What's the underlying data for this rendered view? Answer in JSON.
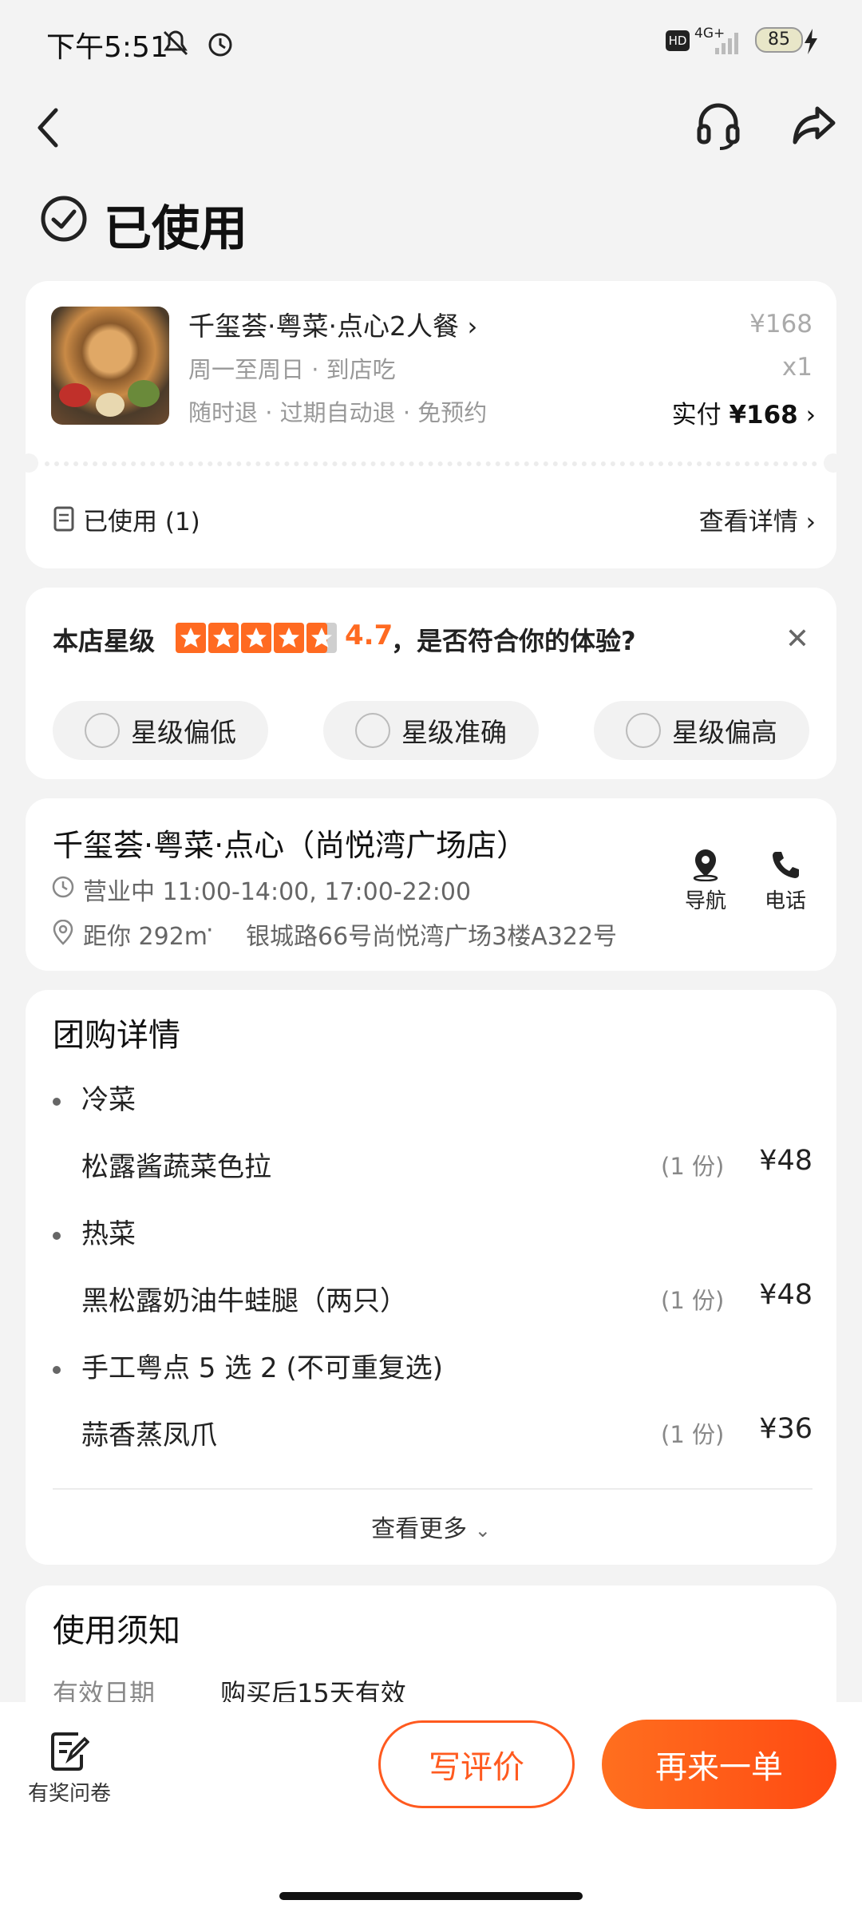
{
  "colors": {
    "accent": "#ff5a1f",
    "star": "#ff6a21",
    "bg": "#f3f3f3"
  },
  "status_bar": {
    "time": "下午5:51",
    "network": "4G+",
    "battery": "85"
  },
  "nav": {
    "icons": [
      "back-icon",
      "headset-icon",
      "share-icon"
    ]
  },
  "page_title": "已使用",
  "order": {
    "name": "千玺荟·粤菜·点心2人餐",
    "schedule": "周一至周日 · 到店吃",
    "policy": "随时退 · 过期自动退 · 免预约",
    "orig_price": "¥168",
    "qty": "x1",
    "paid_label": "实付",
    "paid_value": "¥168",
    "used_label": "已使用 (1)",
    "detail_link": "查看详情"
  },
  "rating": {
    "label": "本店星级",
    "score": "4.7",
    "stars_value": 4.7,
    "question": "，是否符合你的体验?",
    "options": [
      "星级偏低",
      "星级准确",
      "星级偏高"
    ]
  },
  "store": {
    "name": "千玺荟·粤菜·点心（尚悦湾广场店）",
    "hours": "营业中 11:00-14:00, 17:00-22:00",
    "distance": "距你 292m",
    "address": "银城路66号尚悦湾广场3楼A322号",
    "nav_label": "导航",
    "phone_label": "电话"
  },
  "group": {
    "title": "团购详情",
    "sections": [
      {
        "name": "冷菜",
        "items": [
          {
            "name": "松露酱蔬菜色拉",
            "qty": "(1 份)",
            "price": "¥48"
          }
        ]
      },
      {
        "name": "热菜",
        "items": [
          {
            "name": "黑松露奶油牛蛙腿（两只）",
            "qty": "(1 份)",
            "price": "¥48"
          }
        ]
      },
      {
        "name": "手工粤点 5 选 2 (不可重复选)",
        "items": [
          {
            "name": "蒜香蒸凤爪",
            "qty": "(1 份)",
            "price": "¥36"
          }
        ]
      }
    ],
    "more": "查看更多"
  },
  "notice": {
    "title": "使用须知",
    "row_label": "有效日期",
    "row_value": "购买后15天有效"
  },
  "bottom": {
    "survey": "有奖问卷",
    "review": "写评价",
    "reorder": "再来一单"
  }
}
